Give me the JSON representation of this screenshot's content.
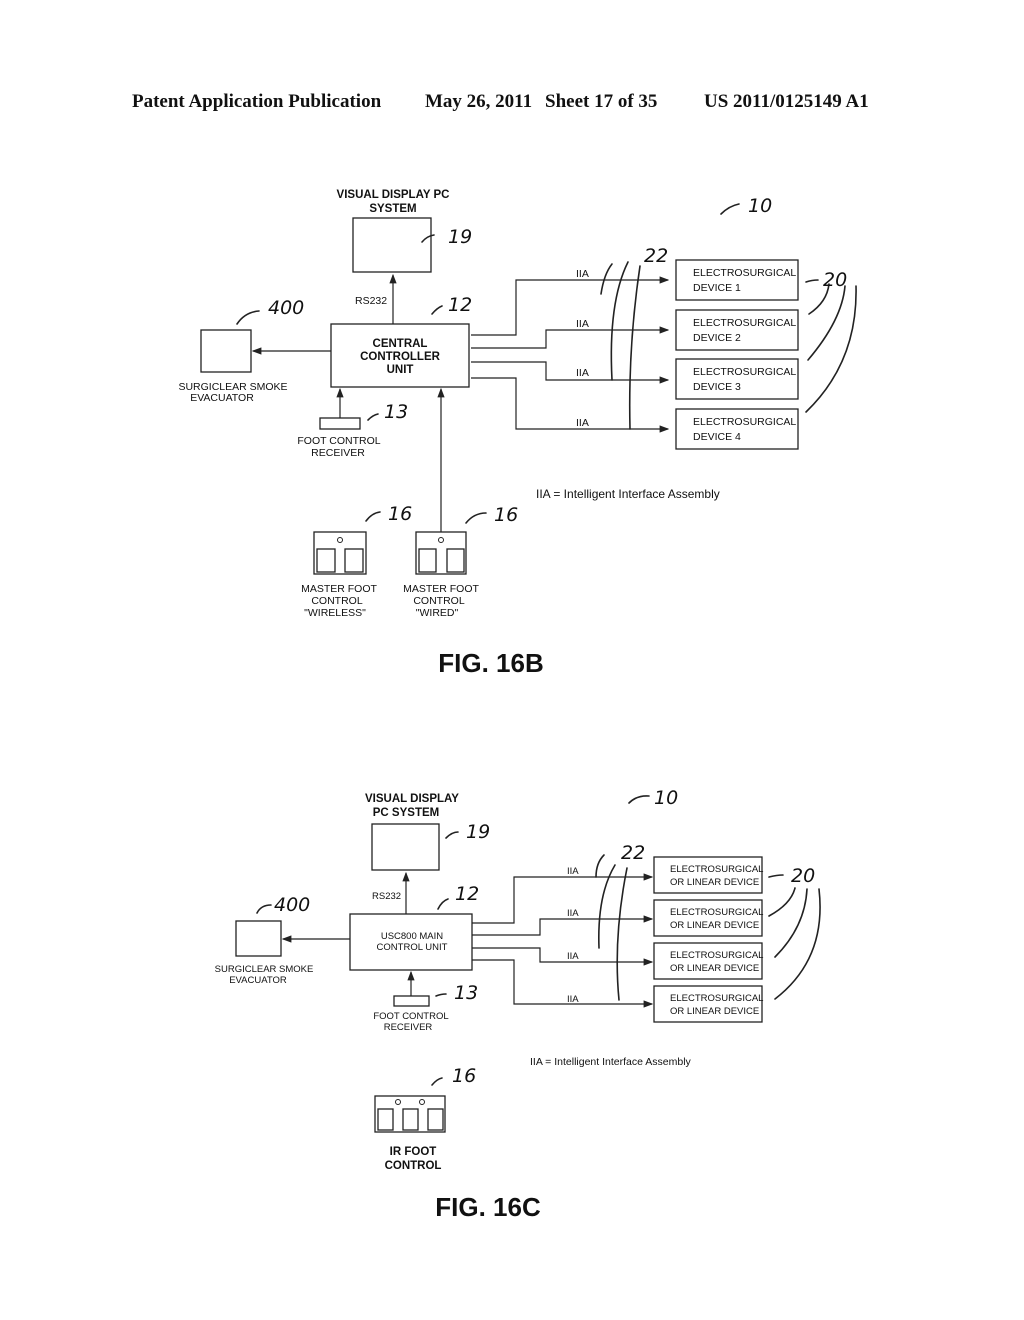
{
  "header": {
    "publication": "Patent Application Publication",
    "date": "May 26, 2011",
    "sheet": "Sheet 17 of 35",
    "number": "US 2011/0125149 A1"
  },
  "fig16b": {
    "caption": "FIG. 16B",
    "display_line1": "VISUAL DISPLAY PC",
    "display_line2": "SYSTEM",
    "rs232": "RS232",
    "controller_line1": "CENTRAL",
    "controller_line2": "CONTROLLER",
    "controller_line3": "UNIT",
    "smoke_line1": "SURGICLEAR  SMOKE",
    "smoke_line2": "EVACUATOR",
    "receiver_line1": "FOOT  CONTROL",
    "receiver_line2": "RECEIVER",
    "devices": [
      {
        "line1": "ELECTROSURGICAL",
        "line2": "DEVICE  1",
        "link": "IIA"
      },
      {
        "line1": "ELECTROSURGICAL",
        "line2": "DEVICE  2",
        "link": "IIA"
      },
      {
        "line1": "ELECTROSURGICAL",
        "line2": "DEVICE  3",
        "link": "IIA"
      },
      {
        "line1": "ELECTROSURGICAL",
        "line2": "DEVICE  4",
        "link": "IIA"
      }
    ],
    "legend": "IIA  =  Intelligent  Interface  Assembly",
    "foot_wireless": [
      "MASTER  FOOT",
      "CONTROL",
      "\"WIRELESS\""
    ],
    "foot_wired": [
      "MASTER  FOOT",
      "CONTROL",
      "\"WIRED\""
    ],
    "refs": {
      "system": "10",
      "display": "19",
      "controller": "12",
      "smoke": "400",
      "receiver": "13",
      "iia": "22",
      "devices": "20",
      "foot1": "16",
      "foot2": "16"
    }
  },
  "fig16c": {
    "caption": "FIG. 16C",
    "display_line1": "VISUAL DISPLAY",
    "display_line2": "PC SYSTEM",
    "rs232": "RS232",
    "controller_line1": "USC800  MAIN",
    "controller_line2": "CONTROL  UNIT",
    "smoke_line1": "SURGICLEAR  SMOKE",
    "smoke_line2": "EVACUATOR",
    "receiver_line1": "FOOT  CONTROL",
    "receiver_line2": "RECEIVER",
    "devices": [
      {
        "line1": "ELECTROSURGICAL",
        "line2": "OR  LINEAR  DEVICE",
        "link": "IIA"
      },
      {
        "line1": "ELECTROSURGICAL",
        "line2": "OR  LINEAR  DEVICE",
        "link": "IIA"
      },
      {
        "line1": "ELECTROSURGICAL",
        "line2": "OR  LINEAR  DEVICE",
        "link": "IIA"
      },
      {
        "line1": "ELECTROSURGICAL",
        "line2": "OR  LINEAR  DEVICE",
        "link": "IIA"
      }
    ],
    "legend": "IIA  =  Intelligent  Interface  Assembly",
    "ir_line1": "IR FOOT",
    "ir_line2": "CONTROL",
    "refs": {
      "system": "10",
      "display": "19",
      "controller": "12",
      "smoke": "400",
      "receiver": "13",
      "iia": "22",
      "devices": "20",
      "foot": "16"
    }
  }
}
